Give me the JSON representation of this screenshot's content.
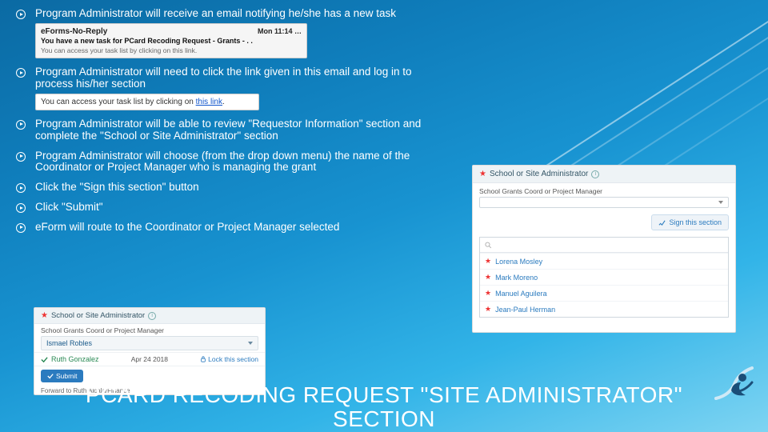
{
  "bullets": {
    "b1": "Program Administrator will receive an email notifying he/she has a new task",
    "b2": "Program Administrator will need to click the link given in this email and log in to process his/her section",
    "b3": "Program Administrator will be able to review \"Requestor Information\" section and complete the \"School or Site Administrator\" section",
    "b4": "Program Administrator will choose (from the drop down menu) the name of the Coordinator or Project Manager who is managing the grant",
    "b5": "Click the \"Sign this section\" button",
    "b6": "Click \"Submit\"",
    "b7": "eForm will route to the Coordinator or Project Manager selected"
  },
  "email1": {
    "from": "eForms-No-Reply",
    "subject": "You have a new task for PCard Recoding Request - Grants - . .",
    "time": "Mon 11:14 …",
    "body": "You can access your task list by clicking on this link."
  },
  "linkshot": {
    "prefix": "You can access your task list by clicking on ",
    "link": "this link",
    "suffix": "."
  },
  "panel_bl": {
    "header": "School or Site Administrator",
    "field_label": "School Grants Coord or Project Manager",
    "field_value": "Ismael Robles",
    "signed_name": "Ruth Gonzalez",
    "signed_date": "Apr 24 2018",
    "lock_label": "Lock this section",
    "submit_label": "Submit",
    "footnote": "Forward to Ruth Alcala/Finance"
  },
  "panel_r": {
    "header": "School or Site Administrator",
    "field_label": "School Grants Coord or Project Manager",
    "placeholder": "",
    "sign_label": "Sign this section",
    "search_placeholder": "",
    "options": [
      "Lorena Mosley",
      "Mark Moreno",
      "Manuel Aguilera",
      "Jean-Paul Herman"
    ]
  },
  "title": "PCARD RECODING REQUEST \"SITE ADMINISTRATOR\" SECTION"
}
